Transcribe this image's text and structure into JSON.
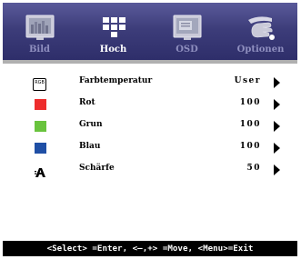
{
  "tabs": [
    {
      "label": "Bild",
      "icon": "picture-icon",
      "active": false
    },
    {
      "label": "Hoch",
      "icon": "advanced-grid-icon",
      "active": true
    },
    {
      "label": "OSD",
      "icon": "osd-window-icon",
      "active": false
    },
    {
      "label": "Optionen",
      "icon": "hand-pointer-icon",
      "active": false
    }
  ],
  "menu": {
    "items": [
      {
        "label": "Farbtemperatur",
        "value": "User",
        "icon": "rgb-icon"
      },
      {
        "label": "Rot",
        "value": "100",
        "icon": "red-swatch-icon",
        "color": "#ee2d2d"
      },
      {
        "label": "Grun",
        "value": "100",
        "icon": "green-swatch-icon",
        "color": "#69c33d"
      },
      {
        "label": "Blau",
        "value": "100",
        "icon": "blue-swatch-icon",
        "color": "#1f4fa5"
      },
      {
        "label": "Schärfe",
        "value": "50",
        "icon": "sharpness-icon"
      }
    ],
    "rgb_icon_text": "RGB"
  },
  "footer": {
    "hint": "<Select> =Enter, <–,+> =Move, <Menu>=Exit"
  },
  "colors": {
    "tabbar": "#3d3d7a",
    "footer_bg": "#000000"
  }
}
